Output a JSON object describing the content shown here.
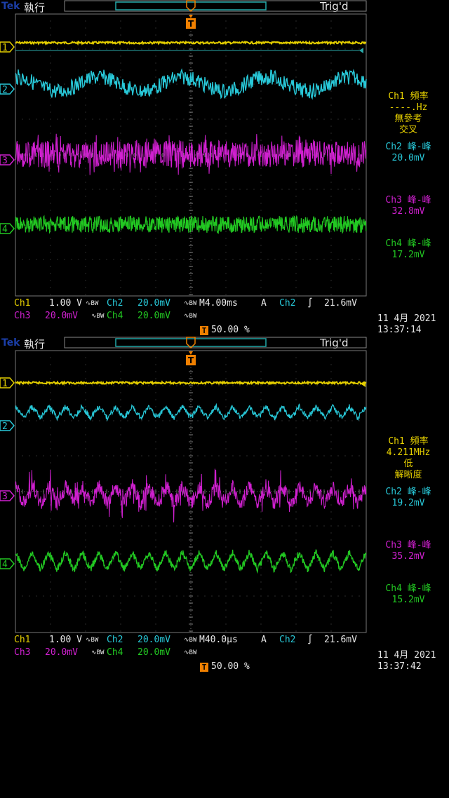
{
  "brand": "Tek",
  "colors": {
    "ch1": "#e6d000",
    "ch2": "#28c8d8",
    "ch3": "#d020d0",
    "ch4": "#22c822",
    "trigger": "#f08000",
    "grid": "#555555"
  },
  "screens": [
    {
      "state": "執行",
      "trig_status": "Trig'd",
      "channel_markers": [
        "1",
        "2",
        "3",
        "4"
      ],
      "trigger_marker": "T",
      "measurements": {
        "ch1_title": "Ch1 頻率",
        "ch1_value": "----.Hz",
        "ch1_note1": "無參考",
        "ch1_note2": "交叉",
        "ch2_title": "Ch2 峰-峰",
        "ch2_value": "20.0mV",
        "ch3_title": "Ch3 峰-峰",
        "ch3_value": "32.8mV",
        "ch4_title": "Ch4 峰-峰",
        "ch4_value": "17.2mV"
      },
      "bottom": {
        "ch1_label": "Ch1",
        "ch1_scale": "1.00 V",
        "ch2_label": "Ch2",
        "ch2_scale": "20.0mV",
        "timebase": "M4.00ms",
        "mode": "A",
        "trig_ch": "Ch2",
        "trig_level": "21.6mV",
        "ch3_label": "Ch3",
        "ch3_scale": "20.0mV",
        "ch4_label": "Ch4",
        "ch4_scale": "20.0mV",
        "trig_pos": "50.00 %",
        "date": "11 4月  2021",
        "time": "13:37:14"
      }
    },
    {
      "state": "執行",
      "trig_status": "Trig'd",
      "channel_markers": [
        "1",
        "2",
        "3",
        "4"
      ],
      "trigger_marker": "T",
      "measurements": {
        "ch1_title": "Ch1 頻率",
        "ch1_value": "4.211MHz",
        "ch1_note1": "低",
        "ch1_note2": "解晰度",
        "ch2_title": "Ch2 峰-峰",
        "ch2_value": "19.2mV",
        "ch3_title": "Ch3 峰-峰",
        "ch3_value": "35.2mV",
        "ch4_title": "Ch4 峰-峰",
        "ch4_value": "15.2mV"
      },
      "bottom": {
        "ch1_label": "Ch1",
        "ch1_scale": "1.00 V",
        "ch2_label": "Ch2",
        "ch2_scale": "20.0mV",
        "timebase": "M40.0µs",
        "mode": "A",
        "trig_ch": "Ch2",
        "trig_level": "21.6mV",
        "ch3_label": "Ch3",
        "ch3_scale": "20.0mV",
        "ch4_label": "Ch4",
        "ch4_scale": "20.0mV",
        "trig_pos": "50.00 %",
        "date": "11 4月  2021",
        "time": "13:37:42"
      }
    }
  ]
}
